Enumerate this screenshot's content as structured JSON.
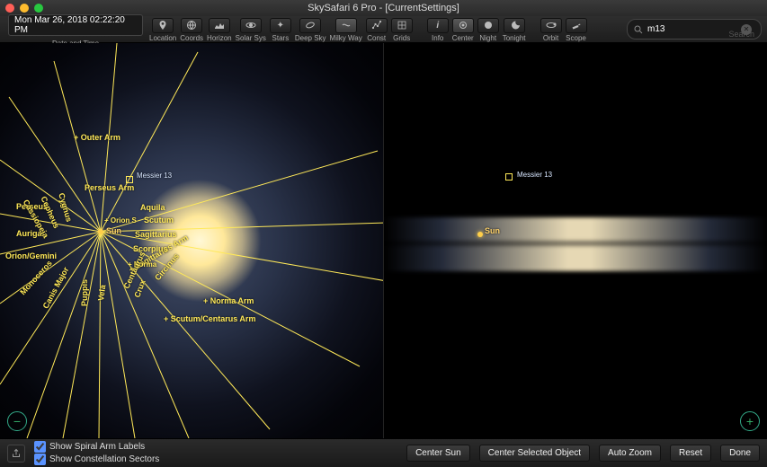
{
  "window": {
    "title": "SkySafari 6 Pro - [CurrentSettings]"
  },
  "toolbar": {
    "datetime": "Mon Mar 26, 2018  02:22:20 PM",
    "datetime_label": "Date and Time",
    "items": [
      {
        "id": "location",
        "label": "Location"
      },
      {
        "id": "coords",
        "label": "Coords"
      },
      {
        "id": "horizon",
        "label": "Horizon"
      },
      {
        "id": "solarsys",
        "label": "Solar Sys"
      },
      {
        "id": "stars",
        "label": "Stars"
      },
      {
        "id": "deepsky",
        "label": "Deep Sky"
      },
      {
        "id": "milkyway",
        "label": "Milky Way"
      },
      {
        "id": "const",
        "label": "Const"
      },
      {
        "id": "grids",
        "label": "Grids"
      },
      {
        "id": "info",
        "label": "Info"
      },
      {
        "id": "center",
        "label": "Center"
      },
      {
        "id": "night",
        "label": "Night"
      },
      {
        "id": "tonight",
        "label": "Tonight"
      },
      {
        "id": "orbit",
        "label": "Orbit"
      },
      {
        "id": "scope",
        "label": "Scope"
      }
    ]
  },
  "search": {
    "value": "m13",
    "placeholder": "Search"
  },
  "left_view": {
    "spiral_arms": [
      "+ Outer Arm",
      "+ Orion S",
      "+ Sagittarius Arm",
      "+ Norma",
      "+ Norma Arm",
      "+ Scutum/Centarus Arm"
    ],
    "extra": [
      "Perseus Arm",
      "Sagittarius",
      "Scorpius",
      "Scutum",
      "Aquila",
      "Circinus",
      "Centaurus",
      "Crux",
      "Vela",
      "Puppis",
      "Canis Major",
      "Monoceros",
      "Orion/Gemini",
      "Auriga",
      "Perseus",
      "Cassiopeia",
      "Cepheus",
      "Cygnus"
    ],
    "objects": [
      {
        "name": "Messier 13"
      },
      {
        "name": "Sun"
      }
    ]
  },
  "right_view": {
    "objects": [
      {
        "name": "Messier 13"
      },
      {
        "name": "Sun"
      }
    ]
  },
  "options": {
    "share_label": "Share",
    "show_spiral_arm_labels": {
      "label": "Show Spiral Arm Labels",
      "checked": true
    },
    "show_constellation_sectors": {
      "label": "Show Constellation Sectors",
      "checked": true
    }
  },
  "buttons": {
    "center_sun": "Center Sun",
    "center_selected": "Center Selected Object",
    "auto_zoom": "Auto Zoom",
    "reset": "Reset",
    "done": "Done"
  }
}
